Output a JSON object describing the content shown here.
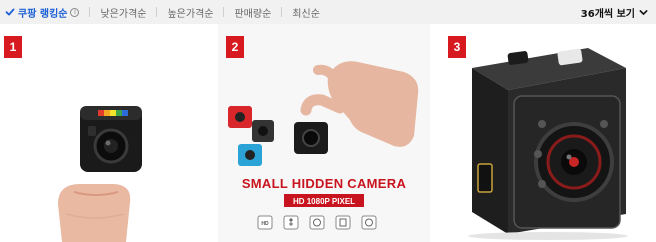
{
  "sort": {
    "items": [
      {
        "label": "쿠팡 랭킹순",
        "active": true
      },
      {
        "label": "낮은가격순",
        "active": false
      },
      {
        "label": "높은가격순",
        "active": false
      },
      {
        "label": "판매량순",
        "active": false
      },
      {
        "label": "최신순",
        "active": false
      }
    ],
    "info_glyph": "i",
    "per_page": "36개씩 보기"
  },
  "products": [
    {
      "rank": "1"
    },
    {
      "rank": "2",
      "banner": "SMALL HIDDEN CAMERA",
      "sub_banner": "HD 1080P PIXEL",
      "feature_icon_text": "HD"
    },
    {
      "rank": "3"
    }
  ],
  "colors": {
    "accent": "#1d5fd6",
    "badge": "#d71920",
    "sortbar_bg": "#f1f1f1",
    "banner_red": "#c8141e"
  }
}
